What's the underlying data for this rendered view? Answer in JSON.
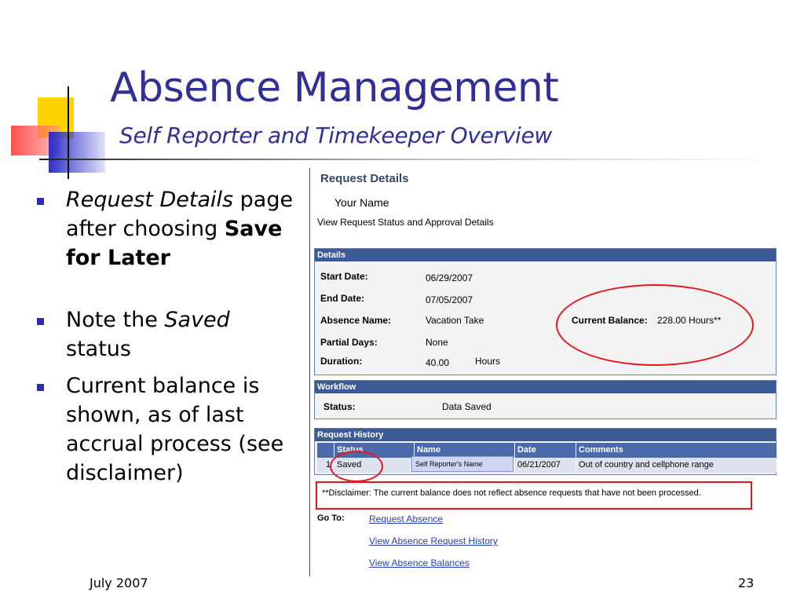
{
  "slide": {
    "title": "Absence Management",
    "subtitle": "Self Reporter and Timekeeper Overview",
    "footer_date": "July 2007",
    "page_number": "23",
    "accent_color": "#2f2f96"
  },
  "bullets": [
    {
      "em": "Request Details",
      "text1": " page after choosing ",
      "strong": "Save for Later"
    },
    {
      "text1": "Note the ",
      "em": "Saved",
      "text2": " status"
    },
    {
      "text1": "Current balance is shown, as of last accrual process (see disclaimer)"
    }
  ],
  "screen": {
    "page_title": "Request Details",
    "user_name": "Your Name",
    "view_status_text": "View Request Status and Approval Details",
    "details": {
      "header": "Details",
      "start_date_label": "Start Date:",
      "start_date": "06/29/2007",
      "end_date_label": "End Date:",
      "end_date": "07/05/2007",
      "absence_name_label": "Absence Name:",
      "absence_name": "Vacation Take",
      "current_balance_label": "Current Balance:",
      "current_balance": "228.00 Hours**",
      "partial_days_label": "Partial Days:",
      "partial_days": "None",
      "duration_label": "Duration:",
      "duration": "40.00",
      "duration_unit": "Hours"
    },
    "workflow": {
      "header": "Workflow",
      "status_label": "Status:",
      "status": "Data Saved"
    },
    "history": {
      "header": "Request History",
      "columns": [
        "Status",
        "Name",
        "Date",
        "Comments"
      ],
      "row": {
        "num": "1",
        "status": "Saved",
        "name": "",
        "date": "06/21/2007",
        "comments": "Out of country and cellphone range"
      },
      "tooltip": "Self Reporter's Name"
    },
    "disclaimer": "**Disclaimer: The current balance does not reflect absence requests that have not been processed.",
    "goto_label": "Go To:",
    "links": [
      "Request Absence",
      "View Absence Request History",
      "View Absence Balances"
    ]
  }
}
